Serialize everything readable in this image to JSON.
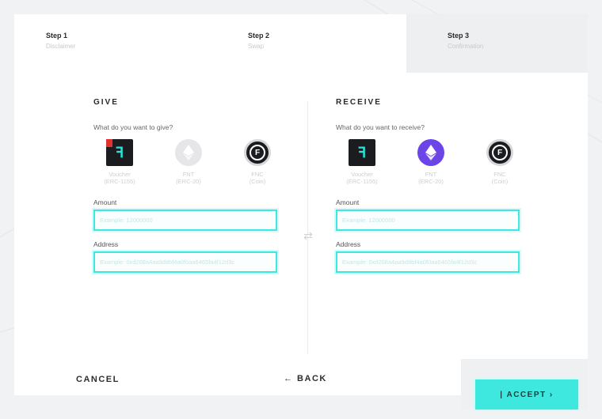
{
  "steps": [
    {
      "title": "Step 1",
      "subtitle": "Disclaimer"
    },
    {
      "title": "Step 2",
      "subtitle": "Swap"
    },
    {
      "title": "Step 3",
      "subtitle": "Confirmation"
    }
  ],
  "give": {
    "title": "GIVE",
    "question": "What do you want to give?",
    "tokens": [
      {
        "icon": "voucher-icon",
        "label_line1": "Voucher",
        "label_line2": "(ERC-1155)"
      },
      {
        "icon": "ethereum-icon",
        "label_line1": "FNT",
        "label_line2": "(ERC-20)"
      },
      {
        "icon": "fnc-coin-icon",
        "label_line1": "FNC",
        "label_line2": "(Coin)"
      }
    ],
    "amount_label": "Amount",
    "amount_placeholder": "Example: 12000000",
    "address_label": "Address",
    "address_placeholder": "Example: 0xd208a4aa9d8bf4a0f0aa6465fa4f12d3c"
  },
  "receive": {
    "title": "RECEIVE",
    "question": "What do you want to receive?",
    "tokens": [
      {
        "icon": "voucher-icon",
        "label_line1": "Voucher",
        "label_line2": "(ERC-1155)"
      },
      {
        "icon": "ethereum-icon",
        "label_line1": "FNT",
        "label_line2": "(ERC-20)"
      },
      {
        "icon": "fnc-coin-icon",
        "label_line1": "FNC",
        "label_line2": "(Coin)"
      }
    ],
    "amount_label": "Amount",
    "amount_placeholder": "Example: 12000000",
    "address_label": "Address",
    "address_placeholder": "Example: 0xd208a4aa9d8bf4a0f0aa6465fa4f12d3c"
  },
  "footer": {
    "cancel_label": "CANCEL",
    "back_label": "← BACK",
    "accept_label": "| ACCEPT  ›"
  },
  "colors": {
    "accent": "#3ee8de",
    "eth_purple": "#6b45e6",
    "voucher_red": "#e3312e"
  }
}
